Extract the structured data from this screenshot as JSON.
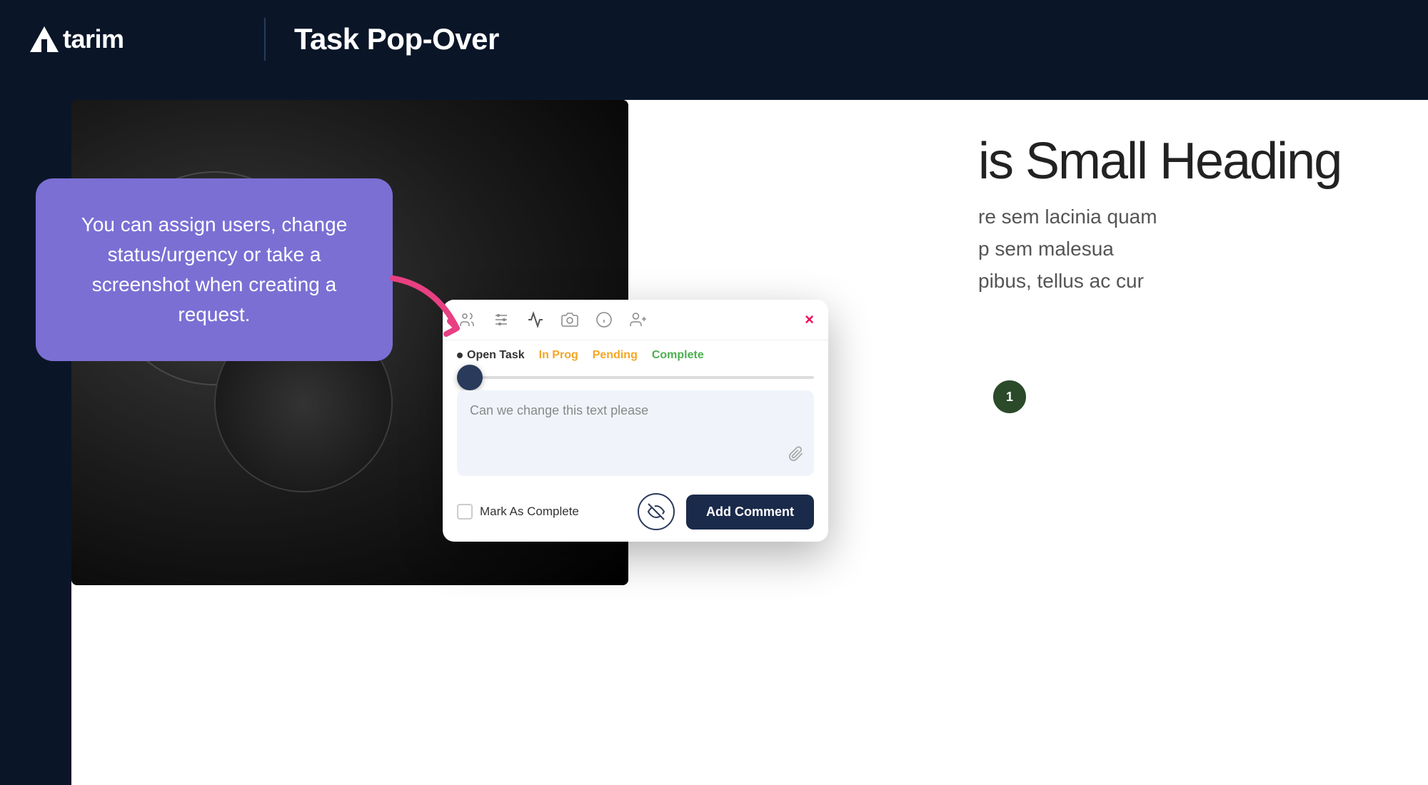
{
  "header": {
    "logo_text": "tarim",
    "title": "Task Pop-Over"
  },
  "tooltip": {
    "text": "You can assign users, change status/urgency or take a screenshot when creating a request."
  },
  "popover": {
    "toolbar": {
      "icons": [
        "users-icon",
        "sliders-icon",
        "activity-icon",
        "camera-icon",
        "info-icon",
        "user-plus-icon"
      ],
      "close_label": "×"
    },
    "status_bar": {
      "open_task_label": "Open Task",
      "in_prog_label": "In Prog",
      "pending_label": "Pending",
      "complete_label": "Complete"
    },
    "comment_placeholder": "Can we change this text please",
    "footer": {
      "mark_complete_label": "Mark As Complete",
      "add_comment_label": "Add Comment"
    }
  },
  "content": {
    "heading": "is Small Heading",
    "body_line1": "re sem lacinia quam",
    "body_line2": "p sem malesua",
    "body_line3": "pibus, tellus ac cur"
  },
  "avatar": {
    "count": "1"
  }
}
